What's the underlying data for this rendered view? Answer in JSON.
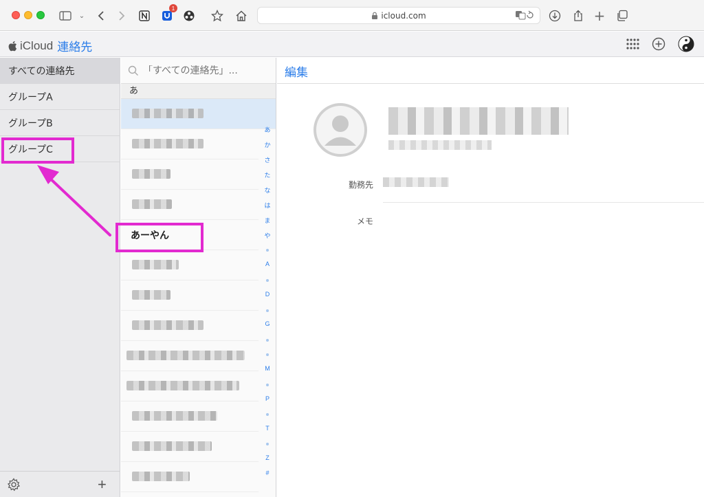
{
  "browser": {
    "url": "icloud.com",
    "extension_badge": "1",
    "colors": {
      "accent": "#2b7de9",
      "highlight": "#e22ad0"
    }
  },
  "app": {
    "brand": "iCloud",
    "name": "連絡先"
  },
  "sidebar": {
    "items": [
      {
        "label": "すべての連絡先",
        "selected": true
      },
      {
        "label": "グループA"
      },
      {
        "label": "グループB"
      },
      {
        "label": "グループC",
        "highlighted": true
      }
    ]
  },
  "contact_list": {
    "search_placeholder": "「すべての連絡先」...",
    "section_header": "あ",
    "highlighted_contact": "あーやん",
    "index_letters": [
      "あ",
      "か",
      "さ",
      "た",
      "な",
      "は",
      "ま",
      "や",
      "A",
      "D",
      "G",
      "M",
      "P",
      "T",
      "Z",
      "#"
    ]
  },
  "detail": {
    "edit_label": "編集",
    "fields": {
      "company_label": "勤務先",
      "memo_label": "メモ"
    }
  }
}
